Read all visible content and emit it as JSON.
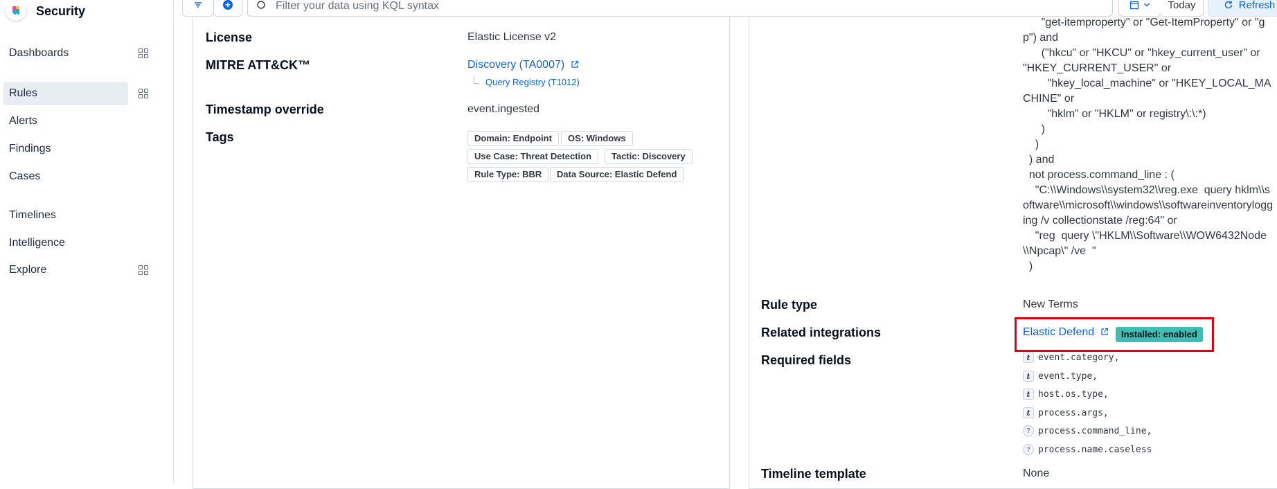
{
  "app": {
    "title": "Security"
  },
  "sidebar": {
    "items": [
      {
        "label": "Dashboards"
      },
      {
        "label": "Rules"
      },
      {
        "label": "Alerts"
      },
      {
        "label": "Findings"
      },
      {
        "label": "Cases"
      },
      {
        "label": "Timelines"
      },
      {
        "label": "Intelligence"
      },
      {
        "label": "Explore"
      }
    ]
  },
  "topbar": {
    "search_placeholder": "Filter your data using KQL syntax",
    "date_label": "Today",
    "refresh_label": "Refresh"
  },
  "about": {
    "license_label": "License",
    "license_value": "Elastic License v2",
    "mitre_label": "MITRE ATT&CK™",
    "mitre_tactic": "Discovery (TA0007)",
    "mitre_technique": "Query Registry (T1012)",
    "timestamp_label": "Timestamp override",
    "timestamp_value": "event.ingested",
    "tags_label": "Tags",
    "tags": [
      "Domain: Endpoint",
      "OS: Windows",
      "Use Case: Threat Detection",
      "Tactic: Discovery",
      "Rule Type: BBR",
      "Data Source: Elastic Defend"
    ]
  },
  "definition": {
    "query_text": "      \"get-itemproperty\" or \"Get-ItemProperty\" or \"gp\") and\n      (\"hkcu\" or \"HKCU\" or \"hkey_current_user\" or \"HKEY_CURRENT_USER\" or\n        \"hkey_local_machine\" or \"HKEY_LOCAL_MACHINE\" or\n        \"hklm\" or \"HKLM\" or registry\\:\\:*)\n      )\n    )\n  ) and\n  not process.command_line : (\n    \"C:\\\\Windows\\\\system32\\\\reg.exe  query hklm\\\\software\\\\microsoft\\\\windows\\\\softwareinventorylogging /v collectionstate /reg:64\" or\n    \"reg  query \\\"HKLM\\\\Software\\\\WOW6432Node\\\\Npcap\\\" /ve  \"\n  )",
    "rule_type_label": "Rule type",
    "rule_type_value": "New Terms",
    "related_label": "Related integrations",
    "integration_name": "Elastic Defend",
    "integration_badge": "Installed: enabled",
    "required_label": "Required fields",
    "required_fields": [
      {
        "type": "t",
        "name": "event.category,"
      },
      {
        "type": "t",
        "name": "event.type,"
      },
      {
        "type": "t",
        "name": "host.os.type,"
      },
      {
        "type": "t",
        "name": "process.args,"
      },
      {
        "type": "?",
        "name": "process.command_line,"
      },
      {
        "type": "?",
        "name": "process.name.caseless"
      }
    ],
    "timeline_label": "Timeline template",
    "timeline_value": "None"
  },
  "colors": {
    "link": "#0b64dd",
    "badge": "#3ebeb0",
    "highlight": "#e0000f"
  }
}
